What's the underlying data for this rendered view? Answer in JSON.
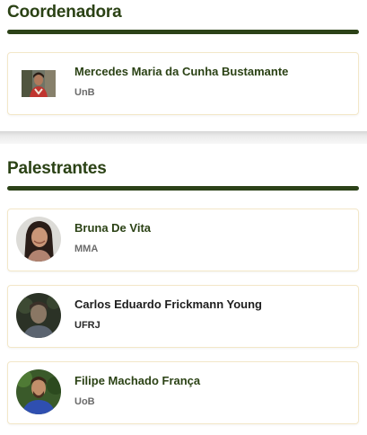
{
  "coordinator_section": {
    "title": "Coordenadora",
    "person": {
      "name": "Mercedes Maria da Cunha Bustamante",
      "affiliation": "UnB"
    }
  },
  "speakers_section": {
    "title": "Palestrantes",
    "people": [
      {
        "name": "Bruna De Vita",
        "affiliation": "MMA"
      },
      {
        "name": "Carlos Eduardo Frickmann Young",
        "affiliation": "UFRJ"
      },
      {
        "name": "Filipe Machado França",
        "affiliation": "UoB"
      }
    ]
  },
  "colors": {
    "heading": "#2b4215",
    "rule": "#2c4218",
    "card_border": "#f3e7c8",
    "affiliation": "#6b6b6b"
  }
}
